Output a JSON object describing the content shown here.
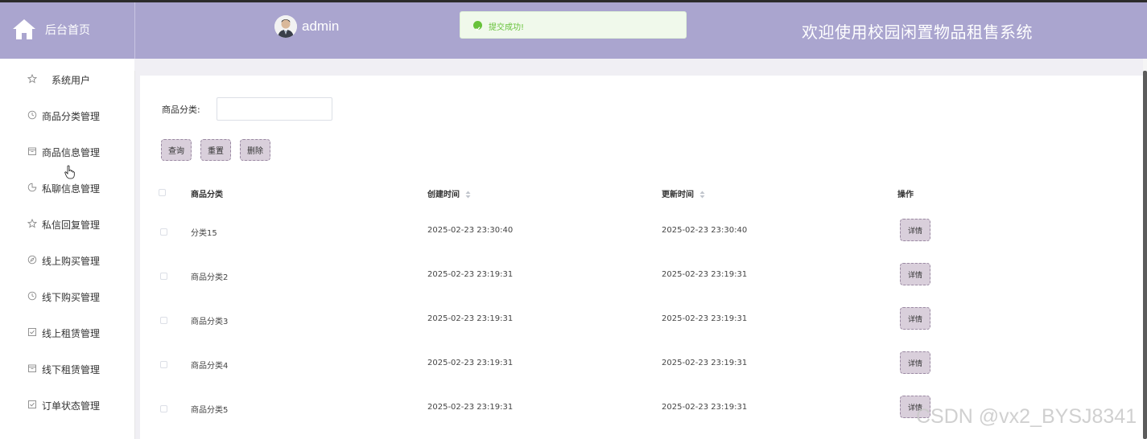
{
  "header": {
    "home_label": "后台首页",
    "username": "admin",
    "toast_text": "提交成功!",
    "title": "欢迎使用校园闲置物品租售系统",
    "accent_color": "#aaa5cf"
  },
  "sidebar": {
    "items": [
      {
        "label": "系统用户",
        "icon": "star-icon"
      },
      {
        "label": "商品分类管理",
        "icon": "clock-icon"
      },
      {
        "label": "商品信息管理",
        "icon": "box-icon"
      },
      {
        "label": "私聊信息管理",
        "icon": "pie-icon"
      },
      {
        "label": "私信回复管理",
        "icon": "star-icon"
      },
      {
        "label": "线上购买管理",
        "icon": "compass-icon"
      },
      {
        "label": "线下购买管理",
        "icon": "clock-icon"
      },
      {
        "label": "线上租赁管理",
        "icon": "check-square-icon"
      },
      {
        "label": "线下租赁管理",
        "icon": "box-icon"
      },
      {
        "label": "订单状态管理",
        "icon": "check-square-icon"
      }
    ]
  },
  "filter": {
    "label": "商品分类:",
    "value": "",
    "placeholder": ""
  },
  "buttons": {
    "query": "查询",
    "reset": "重置",
    "delete": "删除"
  },
  "table": {
    "columns": [
      "商品分类",
      "创建时间",
      "更新时间",
      "操作"
    ],
    "detail_label": "详情",
    "rows": [
      {
        "category": "分类15",
        "created": "2025-02-23 23:30:40",
        "updated": "2025-02-23 23:30:40"
      },
      {
        "category": "商品分类2",
        "created": "2025-02-23 23:19:31",
        "updated": "2025-02-23 23:19:31"
      },
      {
        "category": "商品分类3",
        "created": "2025-02-23 23:19:31",
        "updated": "2025-02-23 23:19:31"
      },
      {
        "category": "商品分类4",
        "created": "2025-02-23 23:19:31",
        "updated": "2025-02-23 23:19:31"
      },
      {
        "category": "商品分类5",
        "created": "2025-02-23 23:19:31",
        "updated": "2025-02-23 23:19:31"
      }
    ]
  },
  "watermark": "CSDN @vx2_BYSJ8341"
}
